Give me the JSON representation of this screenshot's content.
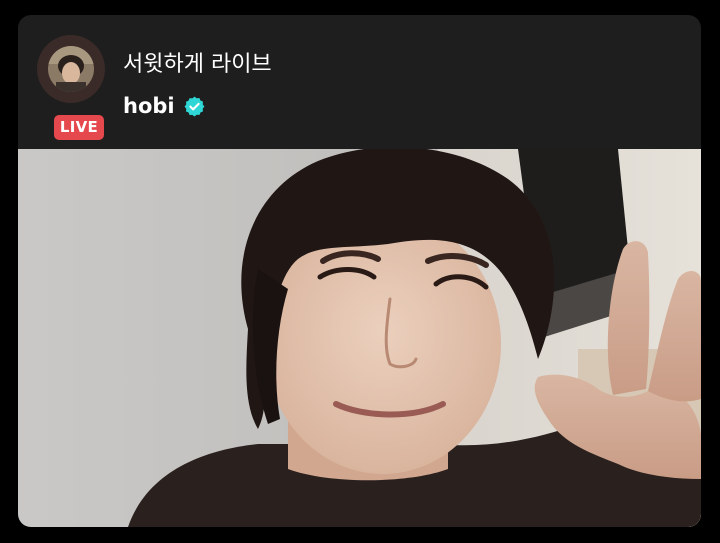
{
  "live": {
    "badge_label": "LIVE",
    "title": "서윗하게 라이브",
    "artist_name": "hobi",
    "verified_icon": "verified-badge-icon",
    "colors": {
      "card_background": "#1e1e1e",
      "page_background": "#000000",
      "live_badge": "#e5484d",
      "verified_badge": "#2fd6d6",
      "text": "#ffffff"
    }
  }
}
